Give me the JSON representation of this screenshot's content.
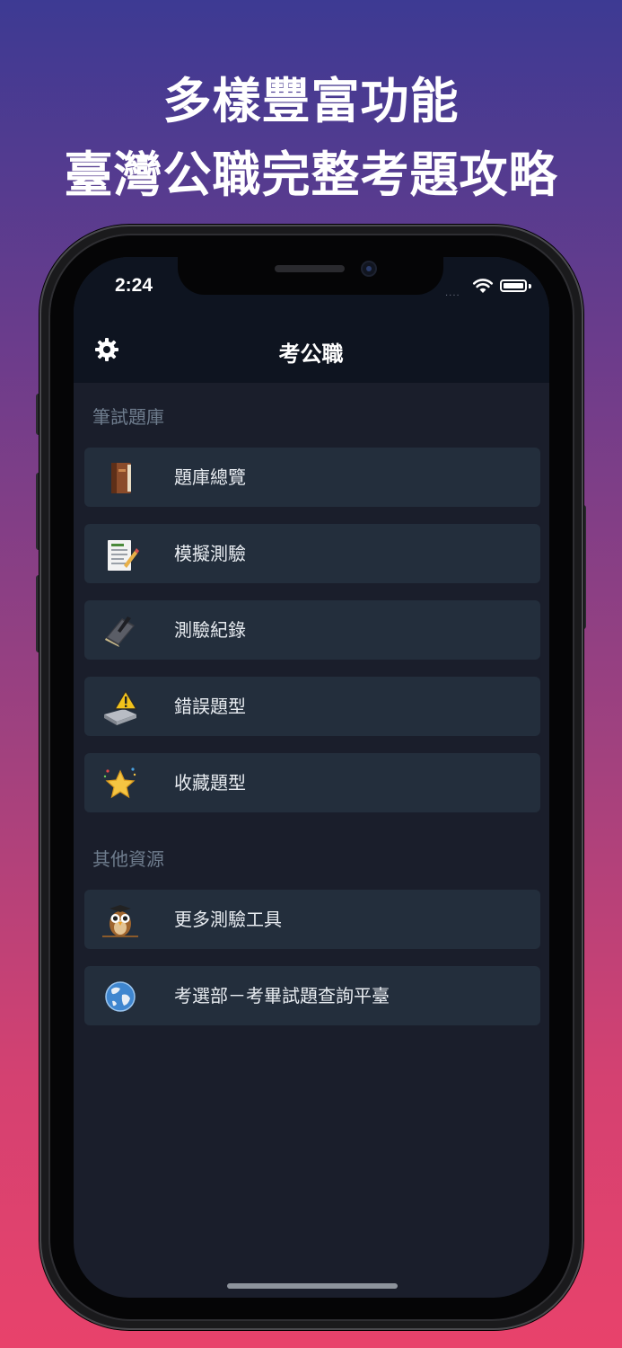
{
  "headline": {
    "line1": "多樣豐富功能",
    "line2": "臺灣公職完整考題攻略"
  },
  "status_bar": {
    "time": "2:24",
    "signal": "....",
    "icons": [
      "wifi-icon",
      "battery-icon"
    ]
  },
  "nav": {
    "title": "考公職",
    "settings_icon": "gear-icon"
  },
  "sections": [
    {
      "label": "筆試題庫",
      "items": [
        {
          "label": "題庫總覽",
          "icon": "book-icon"
        },
        {
          "label": "模擬測驗",
          "icon": "document-pencil-icon"
        },
        {
          "label": "測驗紀錄",
          "icon": "notebook-icon"
        },
        {
          "label": "錯誤題型",
          "icon": "warning-eraser-icon"
        },
        {
          "label": "收藏題型",
          "icon": "star-icon"
        }
      ]
    },
    {
      "label": "其他資源",
      "items": [
        {
          "label": "更多測驗工具",
          "icon": "owl-icon"
        },
        {
          "label": "考選部－考畢試題查詢平臺",
          "icon": "globe-icon"
        }
      ]
    }
  ],
  "colors": {
    "background_top": "#3d3a93",
    "background_bottom": "#e8426b",
    "screen_bg": "#1a1e2b",
    "navbar_bg": "#0e1420",
    "row_bg": "#232e3c",
    "section_label": "#6f7d8e"
  }
}
